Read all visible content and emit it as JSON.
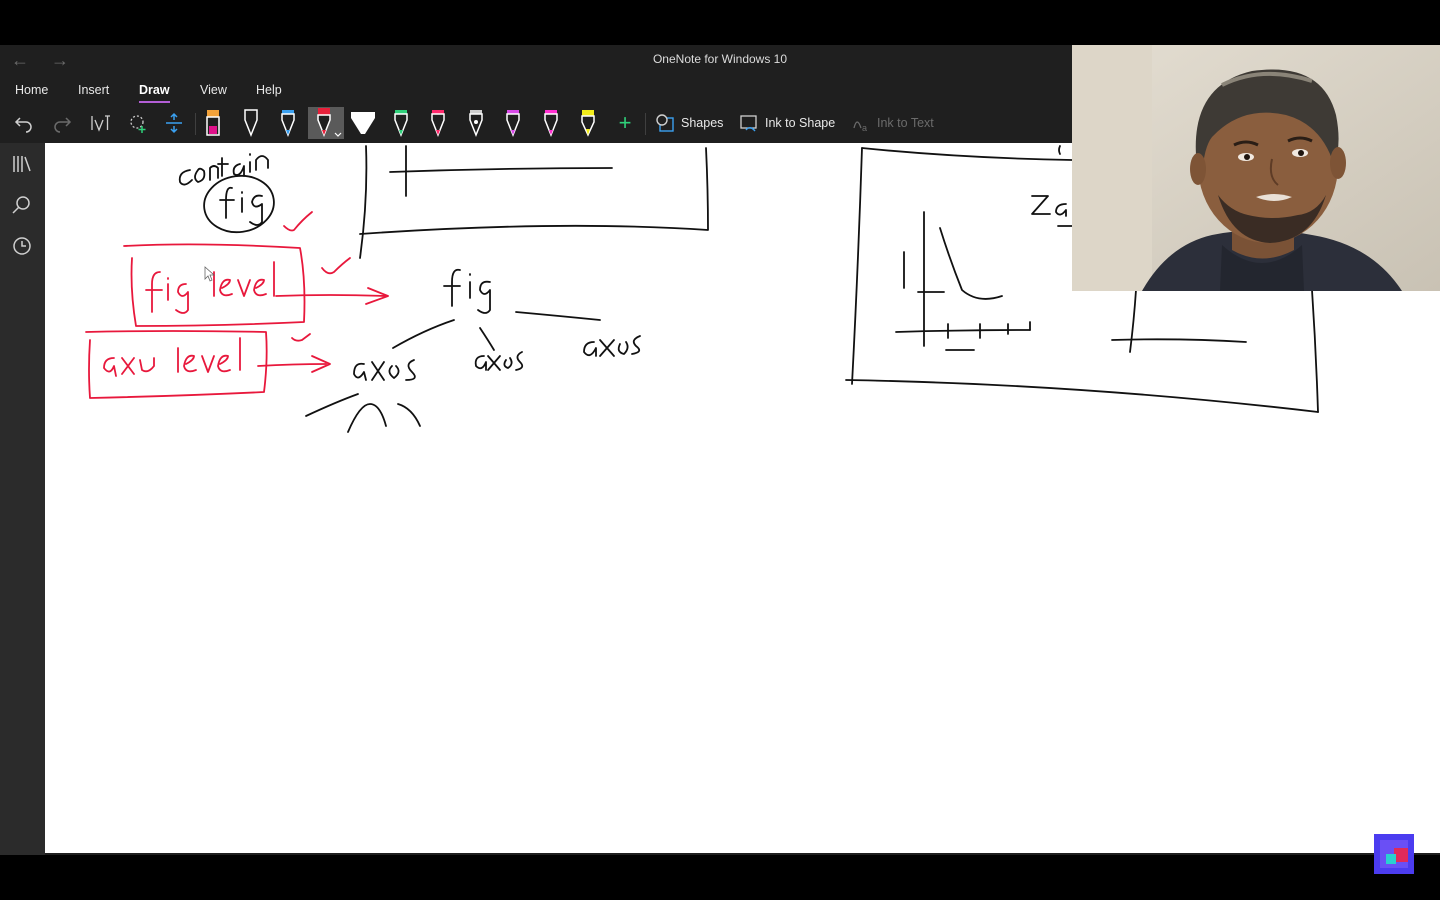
{
  "window": {
    "title": "OneNote for Windows 10"
  },
  "nav": {
    "back_glyph": "←",
    "forward_glyph": "→"
  },
  "menu": {
    "items": [
      "Home",
      "Insert",
      "Draw",
      "View",
      "Help"
    ],
    "active": "Draw"
  },
  "toolbar": {
    "undo_icon": "undo-icon",
    "redo_icon": "redo-icon",
    "lasso_icon": "lasso-select-icon",
    "add_space_icon": "add-space-icon",
    "pens": [
      {
        "name": "highlighter-magenta",
        "color": "#e0118a",
        "band": "#f2a23a"
      },
      {
        "name": "pen-black",
        "color": "#ffffff"
      },
      {
        "name": "pen-blue",
        "color": "#3aa0f0"
      },
      {
        "name": "pen-red",
        "color": "#e8203a",
        "selected": true
      },
      {
        "name": "pen-white-wide",
        "color": "#ffffff"
      },
      {
        "name": "pen-green",
        "color": "#2fd07a"
      },
      {
        "name": "pen-pink",
        "color": "#ff2a6d"
      },
      {
        "name": "pen-gray",
        "color": "#cfcfcf"
      },
      {
        "name": "pen-purple",
        "color": "#d94ae8"
      },
      {
        "name": "pen-magenta",
        "color": "#ff2fd0"
      },
      {
        "name": "pen-yellow",
        "color": "#f2ec1a"
      }
    ],
    "add_pen_glyph": "+",
    "shapes_label": "Shapes",
    "ink_to_shape_label": "Ink to Shape",
    "ink_to_text_label": "Ink to Text"
  },
  "rail": {
    "icons": [
      "notebooks-icon",
      "search-icon",
      "recent-icon"
    ]
  },
  "ink_colors": {
    "black": "#111111",
    "red": "#e8183c"
  }
}
